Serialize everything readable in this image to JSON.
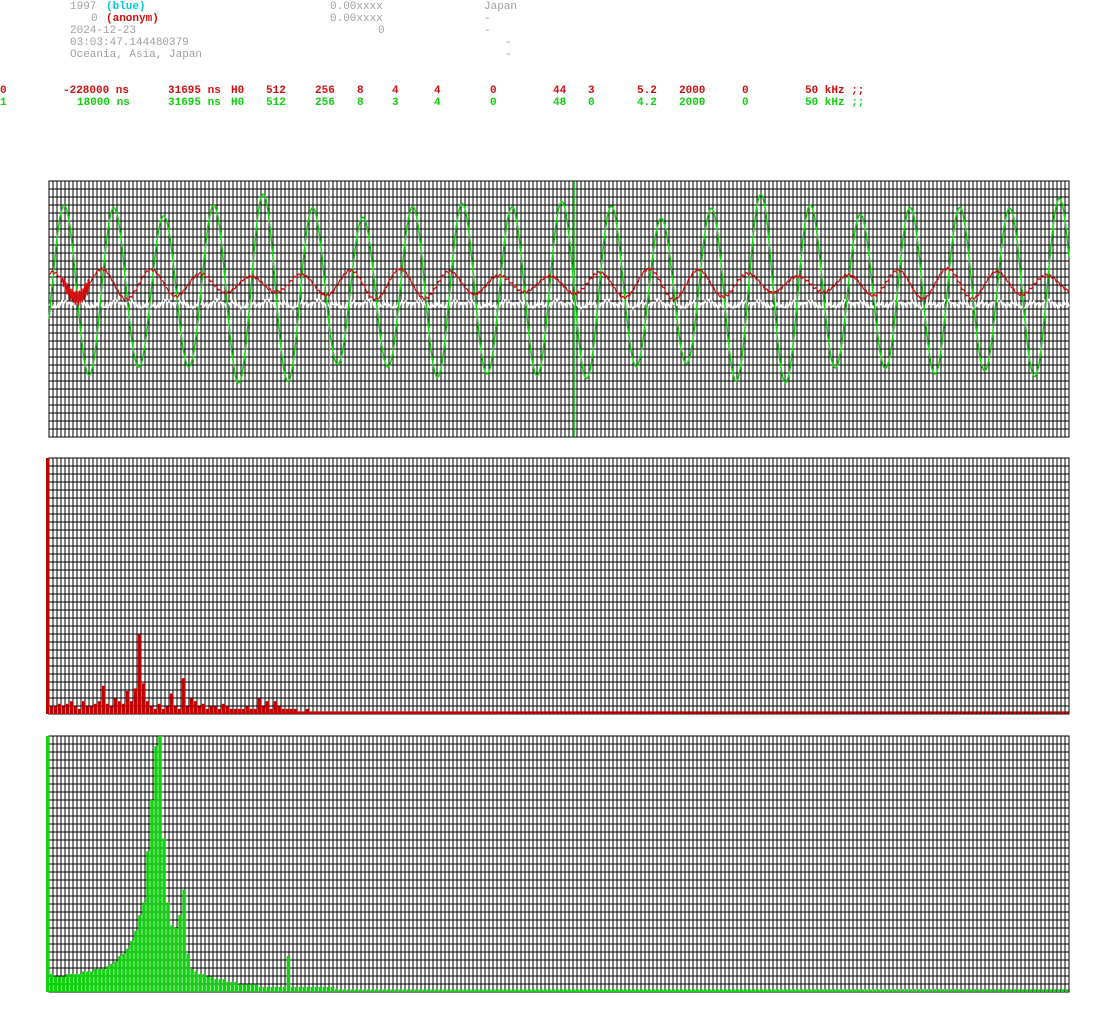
{
  "header": {
    "line1": {
      "id": "1997",
      "name": "(blue)",
      "value": "0.00xxxx",
      "country": "Japan"
    },
    "line2": {
      "id": "0",
      "name": "(anonym)",
      "value": "0.00xxxx",
      "country": "-"
    },
    "line3": {
      "date": "2024-12-23",
      "value": "0",
      "dash": "-"
    },
    "line4": {
      "time": "03:03:47.144480379",
      "dash": "-"
    },
    "line5": {
      "region": "Oceania, Asia, Japan",
      "dash": "-"
    }
  },
  "channels": [
    {
      "idx": "0",
      "offset": "-228000 ns",
      "delay": "31695 ns",
      "h": "H0",
      "a": "512",
      "b": "256",
      "c": "8",
      "d": "4",
      "e": "4",
      "f": "0",
      "g": "44",
      "h2": "3",
      "i": "5.2",
      "j": "2000",
      "k": "0",
      "bw": "50 kHz ;;",
      "color": "#d01010"
    },
    {
      "idx": "1",
      "offset": "18000 ns",
      "delay": "31695 ns",
      "h": "H0",
      "a": "512",
      "b": "256",
      "c": "8",
      "d": "3",
      "e": "4",
      "f": "0",
      "g": "48",
      "h2": "0",
      "i": "4.2",
      "j": "2000",
      "k": "0",
      "bw": "50 kHz ;;",
      "color": "#10d010"
    }
  ],
  "chart_data": [
    {
      "type": "line",
      "series": [
        {
          "color": "#10d010",
          "cycles": 20.5,
          "amplitude_range": [
            0.55,
            0.75
          ]
        },
        {
          "color": "#d01010",
          "cycles": 20.5,
          "amplitude_range": [
            0.06,
            0.12
          ]
        },
        {
          "color": "#ffffff"
        }
      ],
      "grid": true,
      "markers": [
        {
          "x_fraction": 0.275,
          "color": "#e08080"
        },
        {
          "x_fraction": 0.515,
          "color": "#10d010"
        }
      ]
    },
    {
      "type": "bar",
      "color": "#c00000",
      "bins": 256,
      "grid": true,
      "values": [
        1.0,
        0.03,
        0.03,
        0.04,
        0.03,
        0.04,
        0.05,
        0.03,
        0.02,
        0.05,
        0.03,
        0.03,
        0.04,
        0.05,
        0.11,
        0.04,
        0.03,
        0.06,
        0.05,
        0.04,
        0.09,
        0.05,
        0.1,
        0.31,
        0.12,
        0.05,
        0.03,
        0.02,
        0.04,
        0.02,
        0.03,
        0.08,
        0.03,
        0.02,
        0.14,
        0.03,
        0.06,
        0.05,
        0.03,
        0.04,
        0.02,
        0.03,
        0.03,
        0.02,
        0.04,
        0.03,
        0.02,
        0.02,
        0.02,
        0.02,
        0.03,
        0.02,
        0.02,
        0.06,
        0.03,
        0.05,
        0.02,
        0.05,
        0.03,
        0.02,
        0.02,
        0.02,
        0.02,
        0.01,
        0.01,
        0.02,
        0.01,
        0.01,
        0.01,
        0.01,
        0.01,
        0.01,
        0.01,
        0.01,
        0.01,
        0.01,
        0.01,
        0.01,
        0.01,
        0.01,
        0.01,
        0.01,
        0.01,
        0.01,
        0.01,
        0.01,
        0.01,
        0.01,
        0.01,
        0.01,
        0.01,
        0.01,
        0.01,
        0.01,
        0.01,
        0.01,
        0.01,
        0.01,
        0.01,
        0.01,
        0.01,
        0.01,
        0.01,
        0.01,
        0.01,
        0.01,
        0.01,
        0.01,
        0.01,
        0.01,
        0.01,
        0.01,
        0.01,
        0.01,
        0.01,
        0.01,
        0.01,
        0.01,
        0.01,
        0.01,
        0.01,
        0.01,
        0.01,
        0.01,
        0.01,
        0.01,
        0.01,
        0.01,
        0.01,
        0.01,
        0.01,
        0.01,
        0.01,
        0.01,
        0.01,
        0.01,
        0.01,
        0.01,
        0.01,
        0.01,
        0.01,
        0.01,
        0.01,
        0.01,
        0.01,
        0.01,
        0.01,
        0.01,
        0.01,
        0.01,
        0.01,
        0.01,
        0.01,
        0.01,
        0.01,
        0.01,
        0.01,
        0.01,
        0.01,
        0.01,
        0.01,
        0.01,
        0.01,
        0.01,
        0.01,
        0.01,
        0.01,
        0.01,
        0.01,
        0.01,
        0.01,
        0.01,
        0.01,
        0.01,
        0.01,
        0.01,
        0.01,
        0.01,
        0.01,
        0.01,
        0.01,
        0.01,
        0.01,
        0.01,
        0.01,
        0.01,
        0.01,
        0.01,
        0.01,
        0.01,
        0.01,
        0.01,
        0.01,
        0.01,
        0.01,
        0.01,
        0.01,
        0.01,
        0.01,
        0.01,
        0.01,
        0.01,
        0.01,
        0.01,
        0.01,
        0.01,
        0.01,
        0.01,
        0.01,
        0.01,
        0.01,
        0.01,
        0.01,
        0.01,
        0.01,
        0.01,
        0.01,
        0.01,
        0.01,
        0.01,
        0.01,
        0.01,
        0.01,
        0.01,
        0.01,
        0.01,
        0.01,
        0.01,
        0.01,
        0.01,
        0.01,
        0.01,
        0.01,
        0.01,
        0.01,
        0.01,
        0.01,
        0.01,
        0.01,
        0.01,
        0.01,
        0.01,
        0.01,
        0.01,
        0.01,
        0.01,
        0.01,
        0.01,
        0.01,
        0.01,
        0.01,
        0.01,
        0.01,
        0.01,
        0.01,
        0.01
      ]
    },
    {
      "type": "bar",
      "color": "#10d010",
      "bins": 256,
      "grid": true,
      "values": [
        1.0,
        0.07,
        0.06,
        0.06,
        0.06,
        0.07,
        0.07,
        0.07,
        0.07,
        0.08,
        0.08,
        0.08,
        0.09,
        0.09,
        0.09,
        0.1,
        0.11,
        0.12,
        0.14,
        0.15,
        0.17,
        0.2,
        0.24,
        0.3,
        0.35,
        0.55,
        0.75,
        0.96,
        1.0,
        0.6,
        0.35,
        0.26,
        0.25,
        0.3,
        0.4,
        0.15,
        0.09,
        0.08,
        0.07,
        0.07,
        0.06,
        0.06,
        0.05,
        0.05,
        0.05,
        0.04,
        0.04,
        0.04,
        0.03,
        0.03,
        0.03,
        0.03,
        0.03,
        0.02,
        0.02,
        0.02,
        0.02,
        0.02,
        0.02,
        0.02,
        0.14,
        0.02,
        0.02,
        0.02,
        0.02,
        0.02,
        0.02,
        0.02,
        0.02,
        0.02,
        0.02,
        0.02,
        0.01,
        0.01,
        0.01,
        0.01,
        0.01,
        0.01,
        0.01,
        0.01,
        0.01,
        0.01,
        0.01,
        0.01,
        0.01,
        0.01,
        0.01,
        0.01,
        0.01,
        0.01,
        0.01,
        0.01,
        0.01,
        0.01,
        0.01,
        0.01,
        0.01,
        0.01,
        0.01,
        0.01,
        0.01,
        0.01,
        0.01,
        0.01,
        0.01,
        0.01,
        0.01,
        0.01,
        0.01,
        0.01,
        0.01,
        0.01,
        0.01,
        0.01,
        0.01,
        0.01,
        0.01,
        0.01,
        0.01,
        0.01,
        0.01,
        0.01,
        0.01,
        0.01,
        0.01,
        0.01,
        0.01,
        0.01,
        0.01,
        0.01,
        0.01,
        0.01,
        0.01,
        0.01,
        0.01,
        0.01,
        0.01,
        0.01,
        0.01,
        0.01,
        0.01,
        0.01,
        0.01,
        0.01,
        0.01,
        0.01,
        0.01,
        0.01,
        0.01,
        0.01,
        0.01,
        0.01,
        0.01,
        0.01,
        0.01,
        0.01,
        0.01,
        0.01,
        0.01,
        0.01,
        0.01,
        0.01,
        0.01,
        0.01,
        0.01,
        0.01,
        0.01,
        0.01,
        0.01,
        0.01,
        0.01,
        0.01,
        0.01,
        0.01,
        0.01,
        0.01,
        0.01,
        0.01,
        0.01,
        0.01,
        0.01,
        0.01,
        0.01,
        0.01,
        0.01,
        0.01,
        0.01,
        0.01,
        0.01,
        0.01,
        0.01,
        0.01,
        0.01,
        0.01,
        0.01,
        0.01,
        0.01,
        0.01,
        0.01,
        0.01,
        0.01,
        0.01,
        0.01,
        0.01,
        0.01,
        0.01,
        0.01,
        0.01,
        0.01,
        0.01,
        0.01,
        0.01,
        0.01,
        0.01,
        0.01,
        0.01,
        0.01,
        0.01,
        0.01,
        0.01,
        0.01,
        0.01,
        0.01,
        0.01,
        0.01,
        0.01,
        0.01,
        0.01,
        0.01,
        0.01,
        0.01,
        0.01,
        0.01,
        0.01,
        0.01,
        0.01,
        0.01,
        0.01,
        0.01,
        0.01,
        0.01,
        0.01,
        0.01,
        0.01,
        0.01,
        0.01,
        0.01,
        0.01,
        0.01,
        0.01,
        0.01,
        0.01,
        0.01,
        0.01,
        0.01
      ]
    }
  ]
}
